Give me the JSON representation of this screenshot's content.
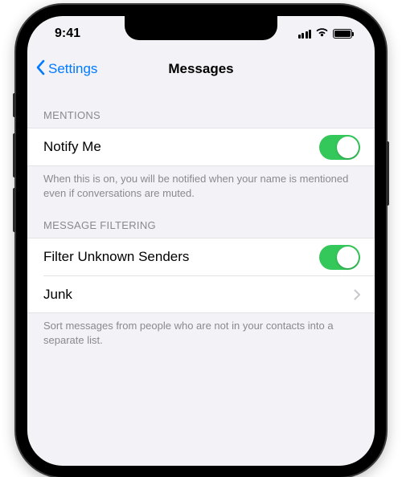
{
  "status": {
    "time": "9:41"
  },
  "nav": {
    "back": "Settings",
    "title": "Messages"
  },
  "sections": {
    "mentions": {
      "header": "MENTIONS",
      "notify_label": "Notify Me",
      "footer": "When this is on, you will be notified when your name is mentioned even if conversations are muted."
    },
    "filtering": {
      "header": "MESSAGE FILTERING",
      "filter_label": "Filter Unknown Senders",
      "junk_label": "Junk",
      "footer": "Sort messages from people who are not in your contacts into a separate list."
    }
  },
  "toggles": {
    "notify_me": true,
    "filter_unknown": true
  },
  "colors": {
    "tint": "#007aff",
    "toggle_on": "#34c759",
    "bg": "#f2f2f7"
  }
}
